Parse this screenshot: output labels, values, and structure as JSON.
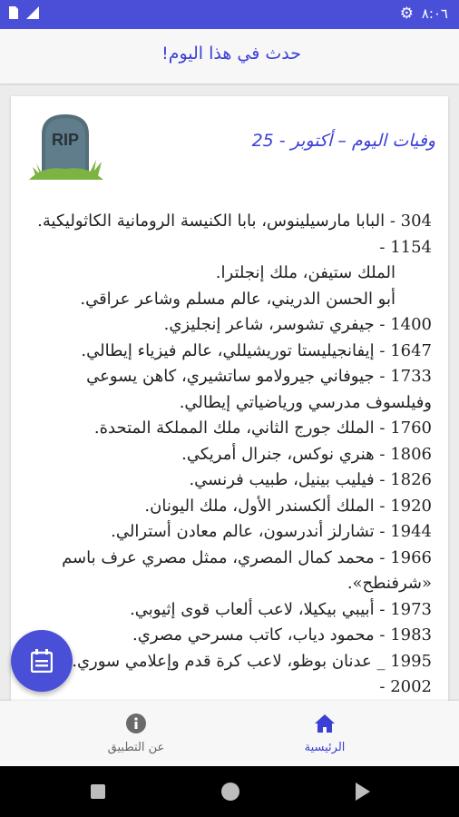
{
  "status_bar": {
    "time": "٨:٠٦"
  },
  "app_bar": {
    "title": "حدث في هذا اليوم!"
  },
  "card": {
    "heading": "وفيات اليوم – أكتوبر - 25",
    "rip_text": "RIP",
    "lines": [
      "304 - البابا مارسيلينوس، بابا الكنيسة الرومانية الكاثوليكية.",
      "1154 -",
      "الملك ستيفن، ملك إنجلترا.",
      "أبو الحسن الدريني، عالم مسلم وشاعر عراقي.",
      "1400 - جيفري تشوسر، شاعر إنجليزي.",
      "1647 - إيفانجيليستا توريشيللي، عالم فيزياء إيطالي.",
      "1733 - جيوفاني جيرولامو ساتشيري، كاهن يسوعي",
      "وفيلسوف مدرسي ورياضياتي إيطالي.",
      "1760 - الملك جورج الثاني، ملك المملكة المتحدة.",
      "1806 - هنري نوكس، جنرال أمريكي.",
      "1826 - فيليب بينيل، طبيب فرنسي.",
      "1920 - الملك ألكسندر الأول، ملك اليونان.",
      "1944 - تشارلز أندرسون، عالم معادن أسترالي.",
      "1966 - محمد كمال المصري، ممثل مصري عرف باسم",
      "«شرفنطح».",
      "1973 - أبيبي بيكيلا، لاعب ألعاب قوى إثيوبي.",
      "1983 - محمود دياب، كاتب مسرحي مصري.",
      "1995 _ عدنان بوظو، لاعب كرة قدم وإعلامي سوري.",
      "2002 -"
    ]
  },
  "bottom_nav": {
    "home_label": "الرئيسية",
    "about_label": "عن التطبيق"
  }
}
